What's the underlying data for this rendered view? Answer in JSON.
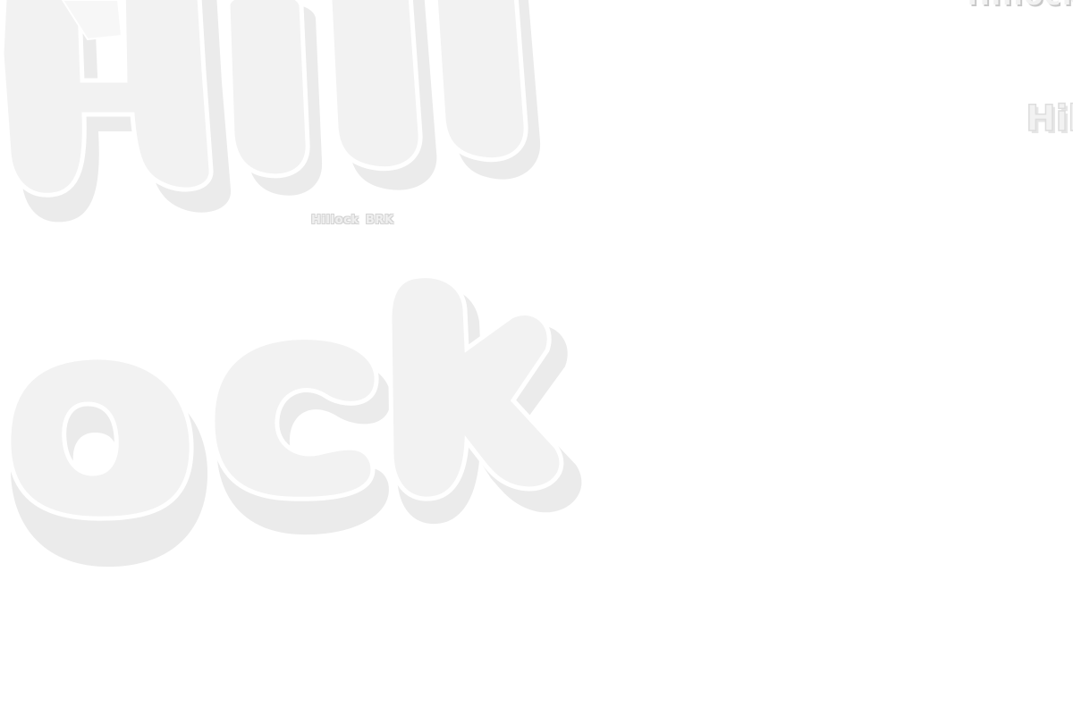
{
  "specimen": {
    "display_top": "Hill",
    "display_bottom": "ock",
    "caption": "Hillock BRK",
    "corner_top_text": "Hillock",
    "corner_mid_text": "Hil"
  },
  "colors": {
    "background": "#ffffff",
    "glyph_fill": "#f2f2f2",
    "glyph_shadow": "#ebebeb",
    "glyph_outline": "#ffffff"
  }
}
